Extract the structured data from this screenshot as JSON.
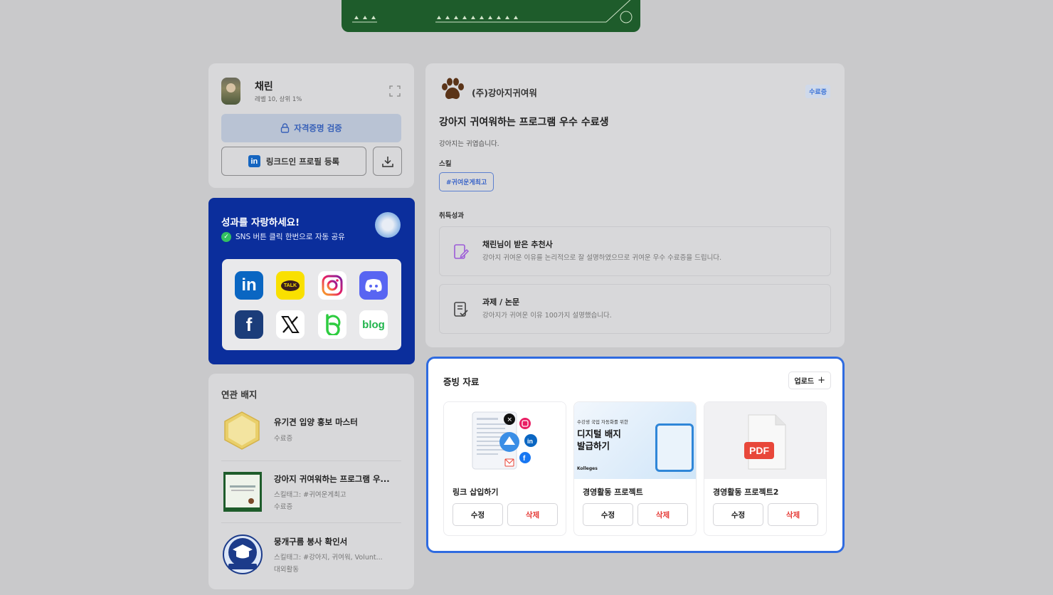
{
  "profile": {
    "name": "채린",
    "subtitle": "레벨 10, 상위 1%",
    "verify_label": "자격증명 검증",
    "linkedin_label": "링크드인 프로필 등록"
  },
  "share": {
    "title": "성과를 자랑하세요!",
    "subtitle": "SNS 버튼 클릭 한번으로 자동 공유",
    "icons": [
      "linkedin-icon",
      "kakaotalk-icon",
      "instagram-icon",
      "discord-icon",
      "facebook-icon",
      "x-icon",
      "band-icon",
      "blog-icon"
    ],
    "kakao_text": "TALK",
    "blog_text": "blog"
  },
  "related": {
    "title": "연관 배지",
    "items": [
      {
        "name": "유기견 입양 홍보 마스터",
        "meta1": "수료증",
        "meta2": "",
        "thumb_text": "유기견 입양 홍보 마스터"
      },
      {
        "name": "강아지 귀여워하는 프로그램 우...",
        "meta1": "스킬태그: #귀여운게최고",
        "meta2": "수료증",
        "thumb_text": "강아지 귀여워하는 프로그램 우수 수료생"
      },
      {
        "name": "뭉개구름 봉사 확인서",
        "meta1": "스킬태그: #강아지, 귀여워, Volunt...",
        "meta2": "대외활동",
        "thumb_text": "뭉개구름 봉사확인서"
      }
    ]
  },
  "detail": {
    "org": "(주)강아지귀여워",
    "status": "수료증",
    "title": "강아지 귀여워하는 프로그램 우수 수료생",
    "description": "강아지는 귀엽습니다.",
    "skill_label": "스킬",
    "skill_tag": "#귀여운게최고",
    "achievement_label": "취득성과",
    "achievements": [
      {
        "title": "채린님이 받은 추천사",
        "desc": "강아지 귀여운 이유를 논리적으로 잘 설명하였으므로 귀여운 우수 수료증을 드립니다."
      },
      {
        "title": "과제 / 논문",
        "desc": "강아지가 귀여운 이유 100가지 설명했습니다."
      }
    ]
  },
  "evidence": {
    "title": "증빙 자료",
    "upload_label": "업로드",
    "edit_label": "수정",
    "delete_label": "삭제",
    "cards": [
      {
        "name": "링크 삽입하기"
      },
      {
        "name": "경영활동 프로젝트",
        "thumb_small": "수강생 국업 자동화를 위한",
        "thumb_title1": "디지털 배지",
        "thumb_title2": "발급하기",
        "thumb_brand": "Kolleges"
      },
      {
        "name": "경영활동 프로젝트2",
        "thumb_label": "PDF"
      }
    ]
  },
  "colors": {
    "accent": "#2f6be0",
    "share_bg": "#0b2e9c",
    "delete": "#e53935",
    "banner": "#1e5c2b"
  }
}
